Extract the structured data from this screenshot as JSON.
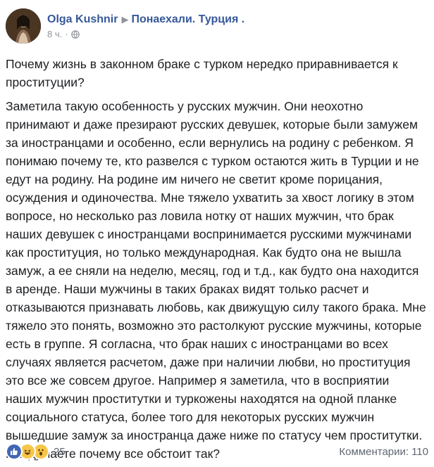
{
  "post": {
    "author": "Olga Kushnir",
    "group": "Понаехали. Турция .",
    "time": "8 ч.",
    "separator": "·",
    "audience_icon": "globe-icon",
    "title": "Почему жизнь в законном браке с турком нередко приравнивается к проституции?",
    "body": "Заметила такую особенность у русских мужчин. Они неохотно принимают и даже презирают русских девушек, которые были замужем за иностранцами и особенно, если вернулись на родину с ребенком. Я понимаю почему те, кто развелся с турком остаются жить в Турции и не едут на родину. На родине им ничего не светит кроме порицания, осуждения и одиночества. Мне тяжело ухватить за хвост логику в этом вопросе, но несколько раз ловила нотку от наших мужчин, что брак наших девушек с иностранцами воспринимается русскими мужчинами как проституция, но только международная. Как будто она не вышла замуж, а ее сняли на неделю, месяц, год и т.д., как будто она находится в аренде. Наши мужчины в таких браках видят только расчет и отказываются признавать любовь, как движущую силу такого брака. Мне тяжело это понять, возможно это растолкуют русские мужчины, которые есть в группе. Я согласна, что брак наших с иностранцами во всех случаях является расчетом, даже при наличии любви, но проституция это все же совсем другое. Например я заметила, что в восприятии наших мужчин проститутки и туркожены находятся на одной планке социального статуса, более того для некоторых русских мужчин вышедшие замуж за иностранца даже ниже по статусу чем проститутки. Как думаете почему все обстоит так?"
  },
  "footer": {
    "reactions": [
      "like-icon",
      "haha-icon",
      "wow-icon"
    ],
    "reaction_count": "25",
    "comments_label": "Комментарии:",
    "comments_count": "110"
  },
  "colors": {
    "link": "#365899",
    "meta": "#90949c",
    "text": "#1c1e21",
    "like": "#4267b2",
    "emoji": "#f7c649"
  }
}
